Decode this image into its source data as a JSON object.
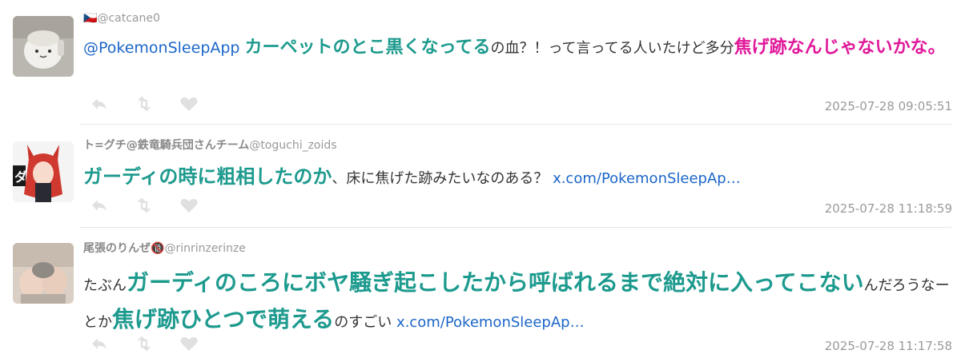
{
  "tweets": [
    {
      "flag": "🇨🇿",
      "name": "",
      "handle": "@catcane0",
      "parts": [
        {
          "text": "@PokemonSleepApp ",
          "style": "mention",
          "size": 19
        },
        {
          "text": "カーペットのとこ黒くなってる",
          "style": "teal",
          "size": 22
        },
        {
          "text": "の血？！って言ってる人いたけど多分",
          "style": "plain",
          "size": 18
        },
        {
          "text": "焦げ跡なんじゃないかな。",
          "style": "pink",
          "size": 22
        }
      ],
      "timestamp": "2025-07-28 09:05:51"
    },
    {
      "flag": "",
      "name": "ト=グチ@鉄竜騎兵団さんチーム",
      "handle": "@toguchi_zoids",
      "parts": [
        {
          "text": "ガーディの時に粗相したのか",
          "style": "teal",
          "size": 24
        },
        {
          "text": "、床に焦げた跡みたいなのある？ ",
          "style": "plain",
          "size": 18
        },
        {
          "text": "x.com/PokemonSleepAp…",
          "style": "link",
          "size": 18
        }
      ],
      "timestamp": "2025-07-28 11:18:59"
    },
    {
      "flag": "",
      "name": "尾張のりんぜ🔞",
      "handle": "@rinrinzerinze",
      "parts": [
        {
          "text": "たぶん",
          "style": "plain",
          "size": 18
        },
        {
          "text": "ガーディのころにボヤ騒ぎ起こしたから呼ばれるまで絶対に入ってこない",
          "style": "teal",
          "size": 28
        },
        {
          "text": "んだろうなーとか",
          "style": "plain",
          "size": 18
        },
        {
          "text": "焦げ跡ひとつで萌える",
          "style": "teal",
          "size": 28
        },
        {
          "text": "のすごい ",
          "style": "plain",
          "size": 18
        },
        {
          "text": "x.com/PokemonSleepAp…",
          "style": "link",
          "size": 18
        }
      ],
      "timestamp": "2025-07-28 11:17:58"
    }
  ],
  "icons": {
    "reply": "reply-icon",
    "retweet": "retweet-icon",
    "like": "heart-icon"
  },
  "colors": {
    "teal": "#1d9a8e",
    "pink": "#e0189a",
    "link": "#1b66c9",
    "meta": "#999999"
  }
}
